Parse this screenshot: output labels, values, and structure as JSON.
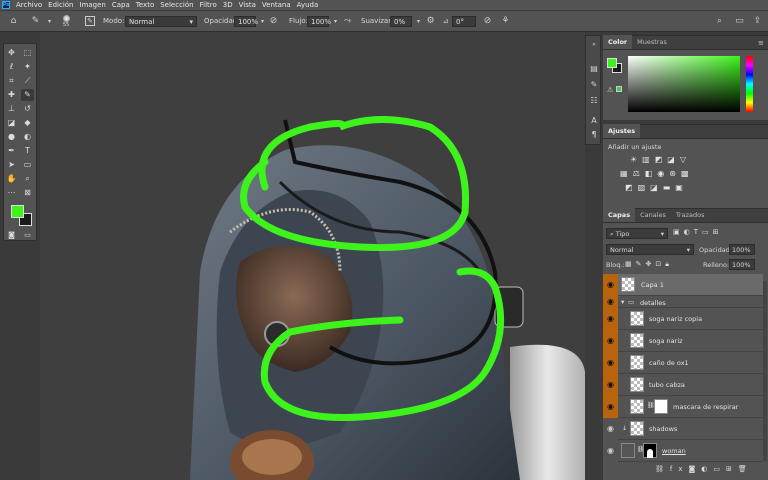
{
  "menu": [
    "Archivo",
    "Edición",
    "Imagen",
    "Capa",
    "Texto",
    "Selección",
    "Filtro",
    "3D",
    "Vista",
    "Ventana",
    "Ayuda"
  ],
  "options": {
    "brush_size": "55",
    "mode_label": "Modo:",
    "mode_value": "Normal",
    "opacity_label": "Opacidad:",
    "opacity_value": "100%",
    "flow_label": "Flujo:",
    "flow_value": "100%",
    "smooth_label": "Suavizar:",
    "smooth_value": "0%",
    "angle_value": "0°"
  },
  "color_panel": {
    "tabs": [
      "Color",
      "Muestras"
    ],
    "foreground": "#3ef31c",
    "background": "#1a1a1a"
  },
  "adjust_panel": {
    "tab": "Ajustes",
    "subtitle": "Añadir un ajuste"
  },
  "layers_panel": {
    "tabs": [
      "Capas",
      "Canales",
      "Trazados"
    ],
    "filter_label": "Tipo",
    "blend_mode": "Normal",
    "opacity_label": "Opacidad:",
    "opacity_value": "100%",
    "lock_label": "Bloq.:",
    "fill_label": "Relleno:",
    "fill_value": "100%",
    "layers": [
      {
        "name": "Capa 1"
      },
      {
        "name": "detalles"
      },
      {
        "name": "soga nariz copia"
      },
      {
        "name": "soga nariz"
      },
      {
        "name": "caño de ox1"
      },
      {
        "name": "tubo cabza"
      },
      {
        "name": "mascara de respirar"
      },
      {
        "name": "shadows"
      },
      {
        "name": "woman"
      }
    ]
  }
}
